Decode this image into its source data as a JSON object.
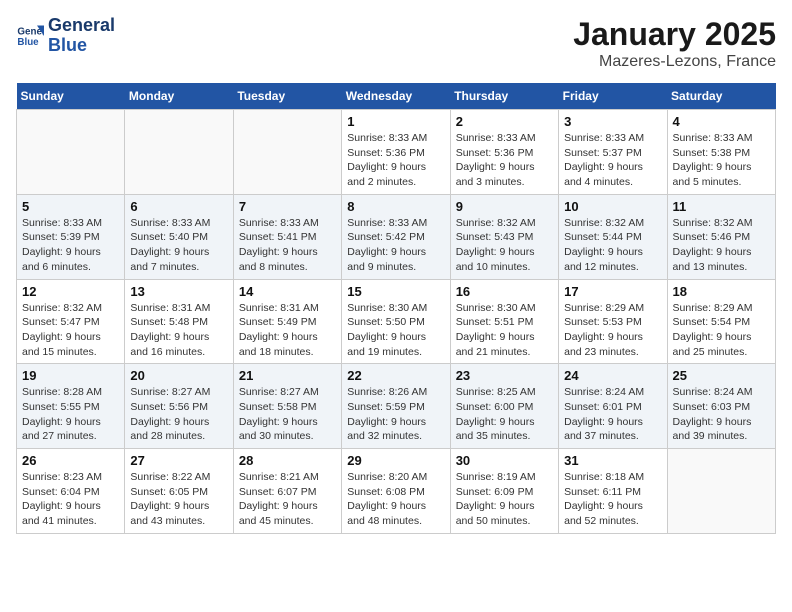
{
  "header": {
    "logo_line1": "General",
    "logo_line2": "Blue",
    "title": "January 2025",
    "subtitle": "Mazeres-Lezons, France"
  },
  "days_of_week": [
    "Sunday",
    "Monday",
    "Tuesday",
    "Wednesday",
    "Thursday",
    "Friday",
    "Saturday"
  ],
  "weeks": [
    [
      {
        "day": "",
        "info": ""
      },
      {
        "day": "",
        "info": ""
      },
      {
        "day": "",
        "info": ""
      },
      {
        "day": "1",
        "info": "Sunrise: 8:33 AM\nSunset: 5:36 PM\nDaylight: 9 hours\nand 2 minutes."
      },
      {
        "day": "2",
        "info": "Sunrise: 8:33 AM\nSunset: 5:36 PM\nDaylight: 9 hours\nand 3 minutes."
      },
      {
        "day": "3",
        "info": "Sunrise: 8:33 AM\nSunset: 5:37 PM\nDaylight: 9 hours\nand 4 minutes."
      },
      {
        "day": "4",
        "info": "Sunrise: 8:33 AM\nSunset: 5:38 PM\nDaylight: 9 hours\nand 5 minutes."
      }
    ],
    [
      {
        "day": "5",
        "info": "Sunrise: 8:33 AM\nSunset: 5:39 PM\nDaylight: 9 hours\nand 6 minutes."
      },
      {
        "day": "6",
        "info": "Sunrise: 8:33 AM\nSunset: 5:40 PM\nDaylight: 9 hours\nand 7 minutes."
      },
      {
        "day": "7",
        "info": "Sunrise: 8:33 AM\nSunset: 5:41 PM\nDaylight: 9 hours\nand 8 minutes."
      },
      {
        "day": "8",
        "info": "Sunrise: 8:33 AM\nSunset: 5:42 PM\nDaylight: 9 hours\nand 9 minutes."
      },
      {
        "day": "9",
        "info": "Sunrise: 8:32 AM\nSunset: 5:43 PM\nDaylight: 9 hours\nand 10 minutes."
      },
      {
        "day": "10",
        "info": "Sunrise: 8:32 AM\nSunset: 5:44 PM\nDaylight: 9 hours\nand 12 minutes."
      },
      {
        "day": "11",
        "info": "Sunrise: 8:32 AM\nSunset: 5:46 PM\nDaylight: 9 hours\nand 13 minutes."
      }
    ],
    [
      {
        "day": "12",
        "info": "Sunrise: 8:32 AM\nSunset: 5:47 PM\nDaylight: 9 hours\nand 15 minutes."
      },
      {
        "day": "13",
        "info": "Sunrise: 8:31 AM\nSunset: 5:48 PM\nDaylight: 9 hours\nand 16 minutes."
      },
      {
        "day": "14",
        "info": "Sunrise: 8:31 AM\nSunset: 5:49 PM\nDaylight: 9 hours\nand 18 minutes."
      },
      {
        "day": "15",
        "info": "Sunrise: 8:30 AM\nSunset: 5:50 PM\nDaylight: 9 hours\nand 19 minutes."
      },
      {
        "day": "16",
        "info": "Sunrise: 8:30 AM\nSunset: 5:51 PM\nDaylight: 9 hours\nand 21 minutes."
      },
      {
        "day": "17",
        "info": "Sunrise: 8:29 AM\nSunset: 5:53 PM\nDaylight: 9 hours\nand 23 minutes."
      },
      {
        "day": "18",
        "info": "Sunrise: 8:29 AM\nSunset: 5:54 PM\nDaylight: 9 hours\nand 25 minutes."
      }
    ],
    [
      {
        "day": "19",
        "info": "Sunrise: 8:28 AM\nSunset: 5:55 PM\nDaylight: 9 hours\nand 27 minutes."
      },
      {
        "day": "20",
        "info": "Sunrise: 8:27 AM\nSunset: 5:56 PM\nDaylight: 9 hours\nand 28 minutes."
      },
      {
        "day": "21",
        "info": "Sunrise: 8:27 AM\nSunset: 5:58 PM\nDaylight: 9 hours\nand 30 minutes."
      },
      {
        "day": "22",
        "info": "Sunrise: 8:26 AM\nSunset: 5:59 PM\nDaylight: 9 hours\nand 32 minutes."
      },
      {
        "day": "23",
        "info": "Sunrise: 8:25 AM\nSunset: 6:00 PM\nDaylight: 9 hours\nand 35 minutes."
      },
      {
        "day": "24",
        "info": "Sunrise: 8:24 AM\nSunset: 6:01 PM\nDaylight: 9 hours\nand 37 minutes."
      },
      {
        "day": "25",
        "info": "Sunrise: 8:24 AM\nSunset: 6:03 PM\nDaylight: 9 hours\nand 39 minutes."
      }
    ],
    [
      {
        "day": "26",
        "info": "Sunrise: 8:23 AM\nSunset: 6:04 PM\nDaylight: 9 hours\nand 41 minutes."
      },
      {
        "day": "27",
        "info": "Sunrise: 8:22 AM\nSunset: 6:05 PM\nDaylight: 9 hours\nand 43 minutes."
      },
      {
        "day": "28",
        "info": "Sunrise: 8:21 AM\nSunset: 6:07 PM\nDaylight: 9 hours\nand 45 minutes."
      },
      {
        "day": "29",
        "info": "Sunrise: 8:20 AM\nSunset: 6:08 PM\nDaylight: 9 hours\nand 48 minutes."
      },
      {
        "day": "30",
        "info": "Sunrise: 8:19 AM\nSunset: 6:09 PM\nDaylight: 9 hours\nand 50 minutes."
      },
      {
        "day": "31",
        "info": "Sunrise: 8:18 AM\nSunset: 6:11 PM\nDaylight: 9 hours\nand 52 minutes."
      },
      {
        "day": "",
        "info": ""
      }
    ]
  ]
}
